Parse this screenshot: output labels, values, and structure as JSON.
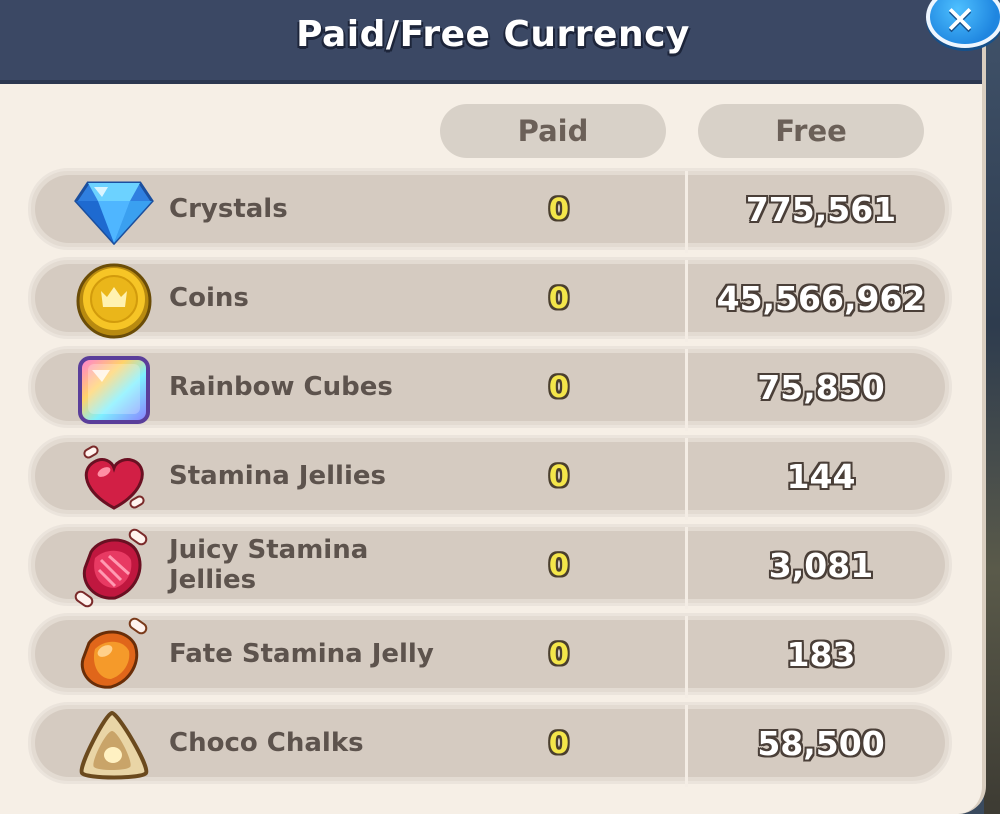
{
  "window": {
    "title": "Paid/Free Currency",
    "close_label": "✕"
  },
  "columns": {
    "paid": "Paid",
    "free": "Free"
  },
  "currencies": [
    {
      "name": "Crystals",
      "icon": "crystal-icon",
      "paid": "0",
      "free": "775,561"
    },
    {
      "name": "Coins",
      "icon": "coin-icon",
      "paid": "0",
      "free": "45,566,962"
    },
    {
      "name": "Rainbow Cubes",
      "icon": "rainbow-cube-icon",
      "paid": "0",
      "free": "75,850"
    },
    {
      "name": "Stamina Jellies",
      "icon": "stamina-jelly-icon",
      "paid": "0",
      "free": "144"
    },
    {
      "name": "Juicy Stamina Jellies",
      "icon": "juicy-stamina-jelly-icon",
      "paid": "0",
      "free": "3,081"
    },
    {
      "name": "Fate Stamina Jelly",
      "icon": "fate-stamina-jelly-icon",
      "paid": "0",
      "free": "183"
    },
    {
      "name": "Choco Chalks",
      "icon": "choco-chalk-icon",
      "paid": "0",
      "free": "58,500"
    }
  ],
  "colors": {
    "titlebar": "#3b4864",
    "panel": "#f6efe6",
    "row": "#d5cbc1",
    "paid_value": "#f4e64a",
    "close_button": "#1f86e0"
  }
}
